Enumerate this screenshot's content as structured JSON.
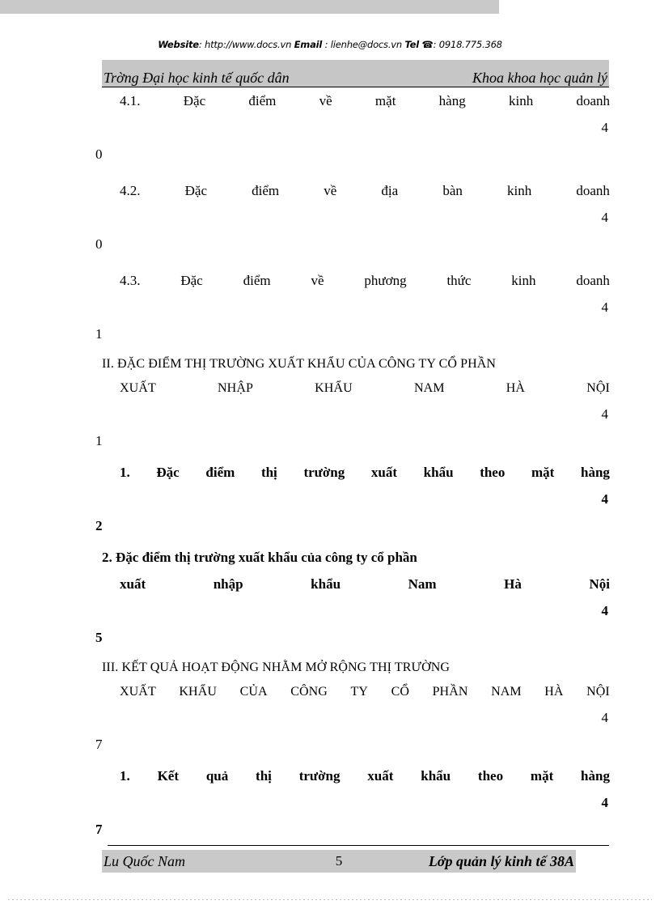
{
  "banner": {
    "website_label": "Website",
    "website_sep": ":",
    "website_url": "http://www.docs.vn",
    "email_label": "Email",
    "email_sep": ":",
    "email_value": "lienhe@docs.vn",
    "tel_label": "Tel",
    "tel_icon": "☎",
    "tel_sep": ":",
    "tel_value": "0918.775.368"
  },
  "header": {
    "left": "Trờng  Đại học kinh tế quốc dân",
    "right": "Khoa khoa học quản lý"
  },
  "toc": {
    "entries": [
      {
        "id": "4-1",
        "number": "4.1.",
        "words": [
          "4.1.",
          "Đặc",
          "điểm",
          "về",
          "mặt",
          "hàng",
          "kinh",
          "doanh"
        ],
        "page": "40",
        "page_head": "4",
        "page_tail": "0",
        "full_text": "4.1. Đặc điểm về mặt hàng kinh doanh",
        "style": "plain"
      },
      {
        "id": "4-2",
        "number": "4.2.",
        "words": [
          "4.2.",
          "Đặc",
          "điểm",
          "về",
          "địa",
          "bàn",
          "kinh",
          "doanh"
        ],
        "page": "40",
        "page_head": "4",
        "page_tail": "0",
        "full_text": "4.2. Đặc điểm về địa bàn kinh doanh",
        "style": "plain"
      },
      {
        "id": "4-3",
        "number": "4.3.",
        "words": [
          "4.3.",
          "Đặc",
          "điểm",
          "về",
          "phương",
          "thức",
          "kinh",
          "doanh"
        ],
        "page": "41",
        "page_head": "4",
        "page_tail": "1",
        "full_text": "4.3. Đặc điểm về phương thức kinh doanh",
        "style": "plain"
      },
      {
        "id": "sec-2",
        "number": "II.",
        "line1": "II. ĐẶC ĐIỂM THỊ TRƯỜNG XUẤT KHẨU CỦA CÔNG TY CỔ PHẦN",
        "words": [
          "XUẤT",
          "NHẬP",
          "KHẨU",
          "NAM",
          "HÀ",
          "NỘI"
        ],
        "page": "41",
        "page_head": "4",
        "page_tail": "1",
        "full_text": "II. ĐẶC ĐIỂM THỊ TRƯỜNG XUẤT KHẨU CỦA CÔNG TY CỔ PHẦN XUẤT NHẬP KHẨU NAM HÀ NỘI",
        "style": "section"
      },
      {
        "id": "ii-1",
        "number": "1.",
        "words": [
          "1.",
          "Đặc",
          "điểm",
          "thị",
          "trường",
          "xuất",
          "khẩu",
          "theo",
          "mặt",
          "hàng"
        ],
        "page": "42",
        "page_head": "4",
        "page_tail": "2",
        "full_text": "1. Đặc điểm thị trường xuất khẩu theo mặt hàng",
        "style": "bold"
      },
      {
        "id": "ii-2",
        "number": "2.",
        "line1": "2. Đặc điểm thị trường xuất khẩu của công ty cổ phần",
        "words": [
          "xuất",
          "nhập",
          "khẩu",
          "Nam",
          "Hà",
          "Nội"
        ],
        "page": "45",
        "page_head": "4",
        "page_tail": "5",
        "full_text": "2. Đặc điểm thị trường xuất khẩu của công ty cổ phần xuất nhập khẩu Nam Hà Nội",
        "style": "bold"
      },
      {
        "id": "sec-3",
        "number": "III.",
        "line1": "III. KẾT QUẢ HOẠT ĐỘNG NHẰM MỞ RỘNG THỊ TRƯỜNG",
        "words": [
          "XUẤT",
          "KHẨU",
          "CỦA",
          "CÔNG",
          "TY",
          "CỔ",
          "PHẦN",
          "NAM",
          "HÀ",
          "NỘI"
        ],
        "page": "47",
        "page_head": "4",
        "page_tail": "7",
        "full_text": "III. KẾT QUẢ HOẠT ĐỘNG NHẰM MỞ RỘNG THỊ TRƯỜNG XUẤT KHẨU CỦA CÔNG TY CỔ PHẦN NAM HÀ NỘI",
        "style": "section"
      },
      {
        "id": "iii-1",
        "number": "1.",
        "words": [
          "1.",
          "Kết",
          "quả",
          "thị",
          "trường",
          "xuất",
          "khẩu",
          "theo",
          "mặt",
          "hàng"
        ],
        "page": "47",
        "page_head": "4",
        "page_tail": "7",
        "full_text": "1. Kết quả thị trường xuất khẩu theo mặt hàng",
        "style": "bold"
      }
    ]
  },
  "footer": {
    "author": "Lu   Quốc Nam",
    "page_number": "5",
    "class": "Lớp quản lý kinh tế 38A"
  },
  "colors": {
    "scan_gray": "#c9c9c9",
    "band_gray": "#c6c6c6",
    "text": "#000000"
  }
}
